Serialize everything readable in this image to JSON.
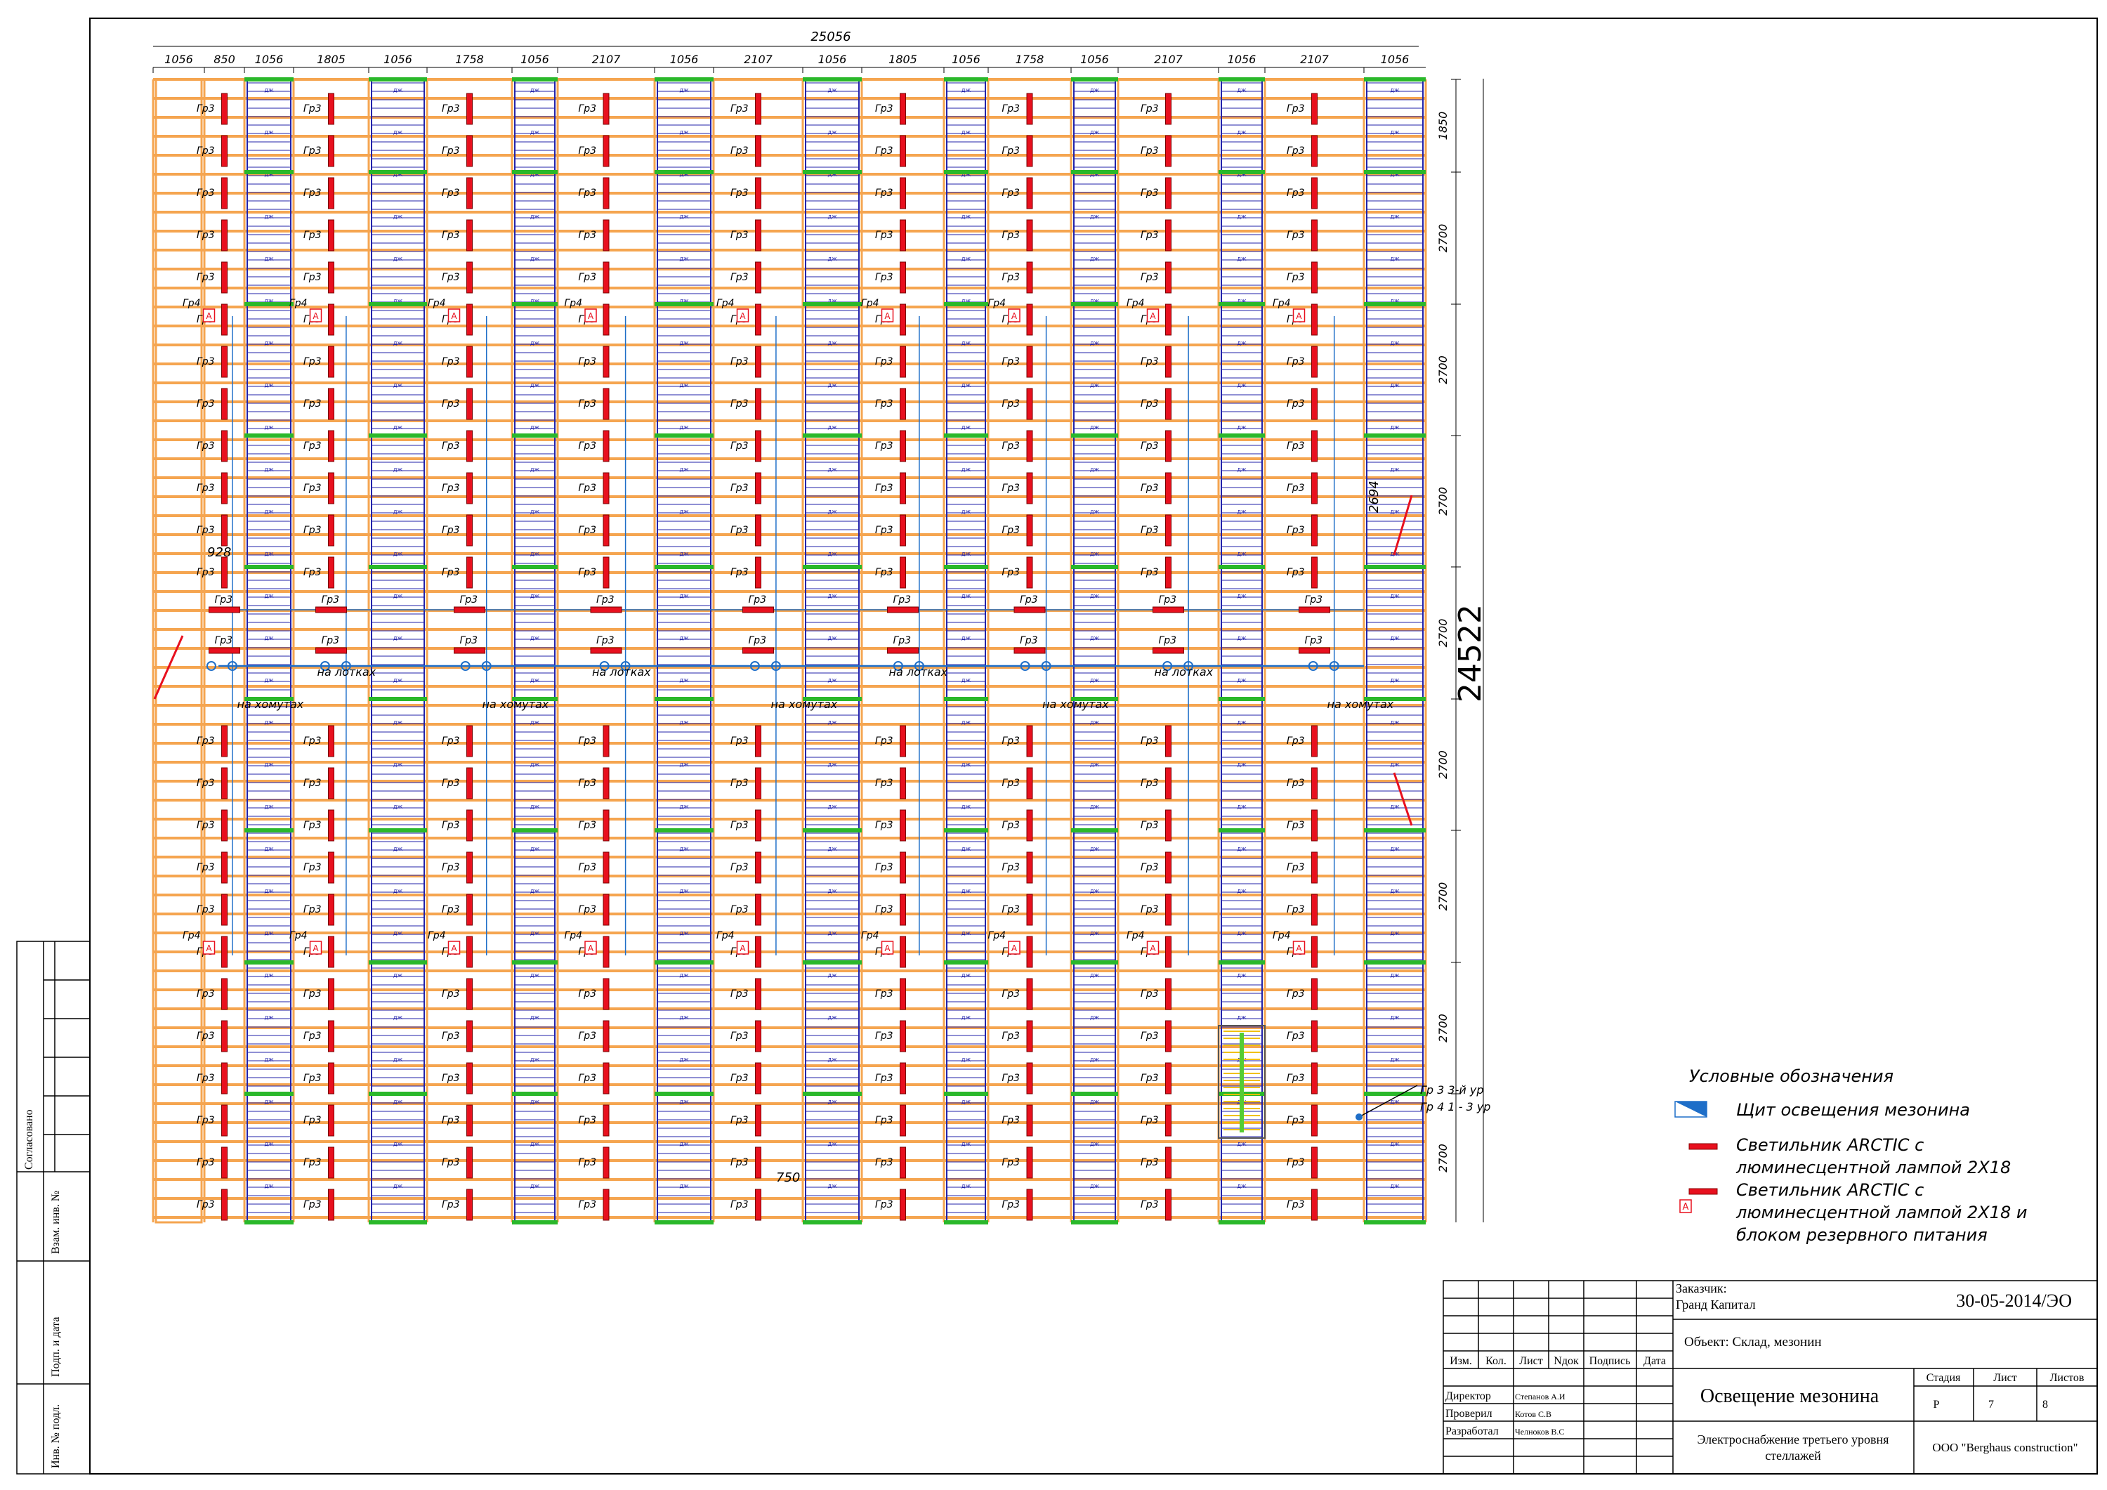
{
  "drawing": {
    "total_width": "25056",
    "total_height": "24522",
    "column_dims": [
      "1056",
      "850",
      "1056",
      "1805",
      "1056",
      "1758",
      "1056",
      "2107",
      "1056",
      "2107",
      "1056",
      "1805",
      "1056",
      "1758",
      "1056",
      "2107",
      "1056",
      "2107",
      "1056"
    ],
    "row_dims": [
      "1850",
      "2700",
      "2700",
      "2700",
      "2700",
      "2700",
      "2700",
      "2700",
      "2700"
    ],
    "extra_dims": {
      "d928": "928",
      "d2694": "2694",
      "d750": "750"
    },
    "group_labels": {
      "gr3": "Гр3",
      "gr4": "Гр4"
    },
    "backup_mark": "A",
    "rack_cell_labels": {
      "a": "ДЖ",
      "b": "ВП"
    },
    "route_labels": {
      "trays": "на лотках",
      "clamps": "на хомутах"
    },
    "riser_note": [
      "Гр 3 3-й ур",
      "Гр 4 1 - 3 ур"
    ],
    "side_stamp_labels": [
      "Согласовано",
      "Взам. инв. №",
      "Подп. и дата",
      "Инв. № подл."
    ]
  },
  "legend": {
    "title": "Условные обозначения",
    "items": [
      {
        "lines": [
          "Щит освещения мезонина"
        ]
      },
      {
        "lines": [
          "Светильник ARCTIC с",
          "люминесцентной лампой 2Х18"
        ]
      },
      {
        "lines": [
          "Светильник ARCTIC с",
          "люминесцентной лампой 2Х18 и",
          "блоком резервного питания"
        ]
      }
    ]
  },
  "title_block": {
    "customer_label": "Заказчик:",
    "customer": "Гранд Капитал",
    "code": "30-05-2014/ЭО",
    "object": "Объект: Склад, мезонин",
    "header_cols": [
      "Изм.",
      "Кол.",
      "Лист",
      "Nдок",
      "Подпись",
      "Дата"
    ],
    "roles": [
      {
        "role": "Директор",
        "name": "Степанов А.И"
      },
      {
        "role": "Проверил",
        "name": "Котов С.В"
      },
      {
        "role": "Разработал",
        "name": "Челноков В.С"
      }
    ],
    "sheet_title": "Освещение мезонина",
    "stage_label": "Стадия",
    "sheet_label": "Лист",
    "sheets_label": "Листов",
    "stage": "Р",
    "sheet": "7",
    "sheets": "8",
    "subtitle": [
      "Электроснабжение третьего уровня",
      "стеллажей"
    ],
    "company": "ООО \"Berghaus construction\""
  },
  "colors": {
    "frame": "#000000",
    "beam": "#f5a550",
    "rack": "#2222aa",
    "fixture": "#e8101e",
    "cable": "#1e6ec8",
    "post": "#2ab82a"
  }
}
